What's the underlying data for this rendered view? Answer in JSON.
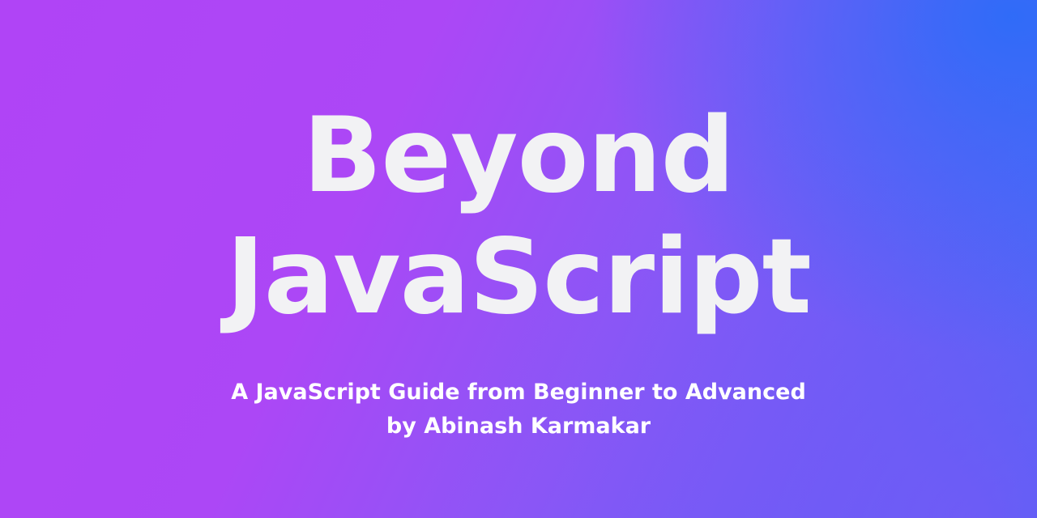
{
  "banner": {
    "title_line_1": "Beyond",
    "title_line_2": "JavaScript",
    "subtitle": "A JavaScript Guide from Beginner to Advanced",
    "byline": "by Abinash Karmakar"
  },
  "colors": {
    "text": "#f2f2f4",
    "gradient_start": "#b044f6",
    "gradient_end": "#2d6cf8"
  }
}
